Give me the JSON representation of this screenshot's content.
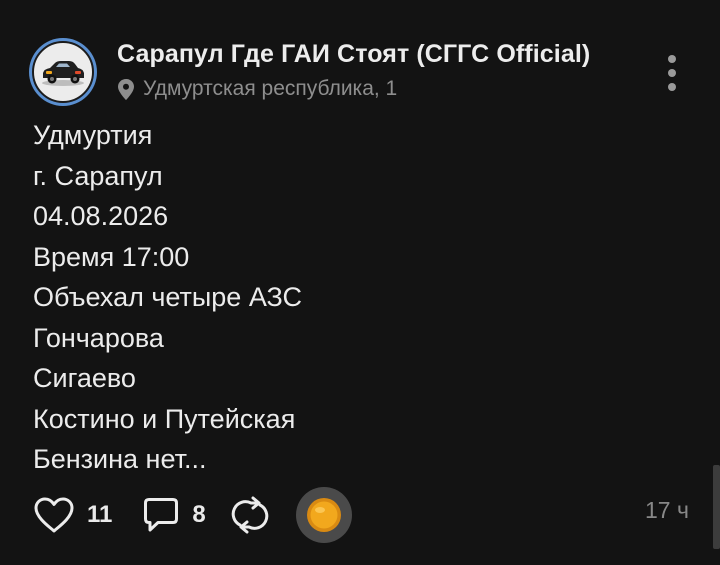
{
  "post": {
    "channel_name": "Сарапул Где ГАИ Стоят (СГГС Official)",
    "location": "Удмуртская республика, 1",
    "lines": [
      "Удмуртия",
      "г. Сарапул",
      "04.08.2026",
      "Время 17:00",
      "Объехал четыре АЗС",
      "Гончарова",
      "Сигаево",
      "Костино и Путейская",
      "Бензина нет..."
    ],
    "time_ago": "17 ч"
  },
  "actions": {
    "likes": "11",
    "comments": "8"
  },
  "icons": {
    "location": "location-pin-icon",
    "more": "more-vertical-icon",
    "like": "heart-icon",
    "comment": "comment-icon",
    "repost": "repost-icon",
    "donate": "coin-icon"
  },
  "colors": {
    "background": "#131313",
    "text": "#ececec",
    "muted": "#8e8e8e",
    "avatar_ring": "#5a8fd0",
    "coin": "#f2a81d"
  }
}
